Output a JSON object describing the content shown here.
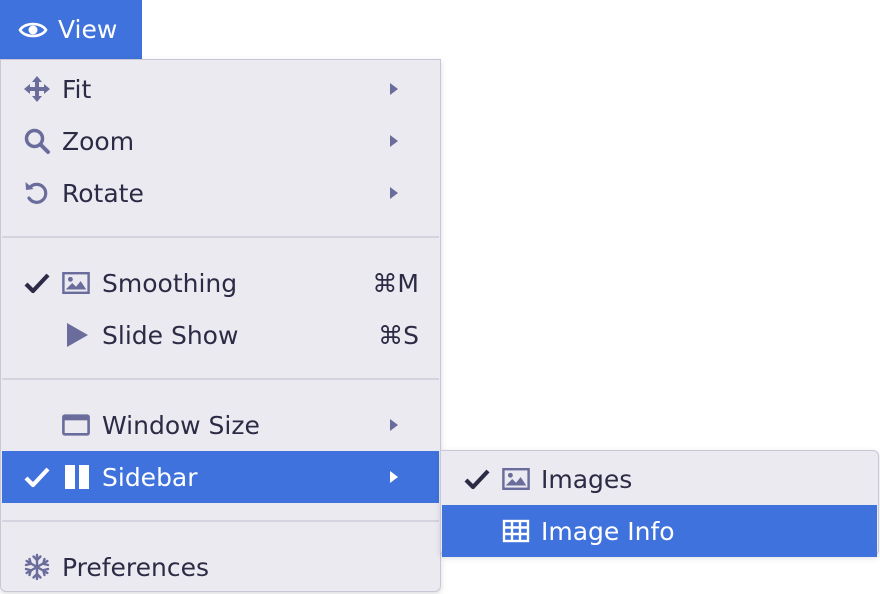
{
  "menubar": {
    "view_label": "View",
    "icon": "eye-icon"
  },
  "view_menu": {
    "items": [
      {
        "label": "Fit",
        "icon": "move-arrows-icon",
        "submenu": true
      },
      {
        "label": "Zoom",
        "icon": "magnifier-icon",
        "submenu": true
      },
      {
        "label": "Rotate",
        "icon": "rotate-ccw-icon",
        "submenu": true
      },
      {
        "label": "Smoothing",
        "icon": "image-icon",
        "checked": true,
        "shortcut": "⌘M"
      },
      {
        "label": "Slide Show",
        "icon": "play-icon",
        "shortcut": "⌘S"
      },
      {
        "label": "Window Size",
        "icon": "window-icon",
        "submenu": true
      },
      {
        "label": "Sidebar",
        "icon": "sidebar-columns-icon",
        "checked": true,
        "submenu": true,
        "active": true
      },
      {
        "label": "Preferences",
        "icon": "snowflake-icon"
      }
    ]
  },
  "sidebar_submenu": {
    "items": [
      {
        "label": "Images",
        "icon": "image-icon",
        "checked": true
      },
      {
        "label": "Image Info",
        "icon": "table-grid-icon",
        "active": true
      }
    ]
  },
  "colors": {
    "accent": "#3f72dc",
    "menu_bg": "#eceaf1",
    "icon": "#6a6c9c",
    "text": "#2c2b45",
    "check": "#2c2b45"
  }
}
